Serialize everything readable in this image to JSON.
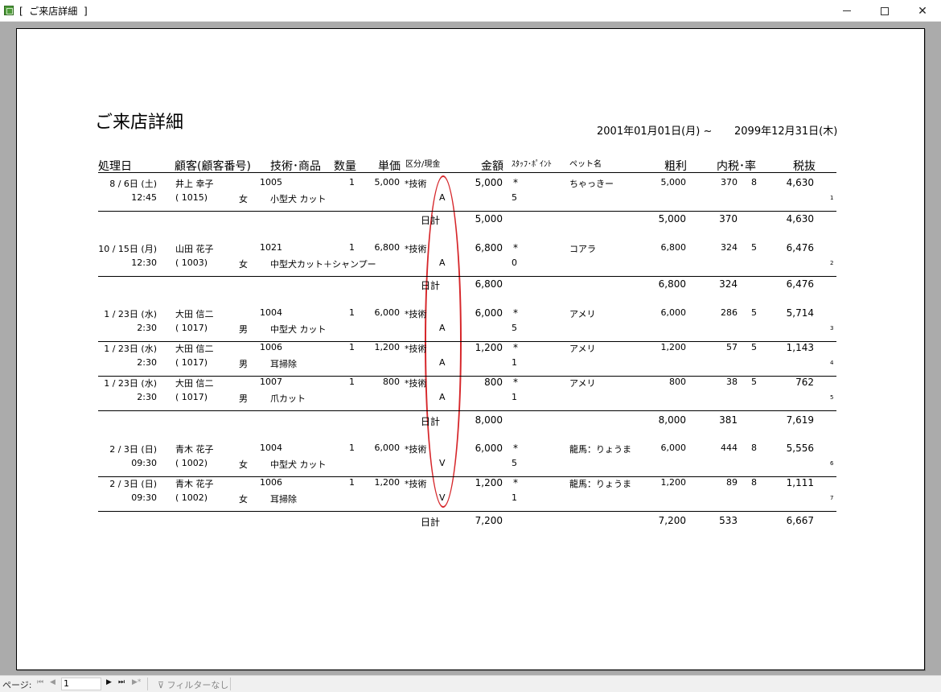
{
  "window": {
    "title": "[  ご来店詳細  ]",
    "minimize": "—",
    "maximize": "☐",
    "close": "✕"
  },
  "report": {
    "title": "ご来店詳細",
    "period_start": "2001年01月01日(月) ~",
    "period_end": "2099年12月31日(木)"
  },
  "headers": {
    "date": "処理日",
    "customer": "顧客(顧客番号)",
    "item": "技術･商品",
    "qty": "数量",
    "unit_price": "単価",
    "category": "区分/現金",
    "amount": "金額",
    "staff_point": "ｽﾀｯﾌ･ﾎﾟｲﾝﾄ",
    "pet_name": "ペット名",
    "gross": "粗利",
    "tax_rate": "内税･率",
    "net": "税抜"
  },
  "records": [
    {
      "date": "8 / 6日 (土)",
      "time": "12:45",
      "name": "井上  幸子",
      "cust_no": "(  1015)",
      "gender": "女",
      "code": "1005",
      "item": "小型犬 カット",
      "qty": "1",
      "unit": "5,000",
      "kind": "*技術",
      "cash": "A",
      "amount": "5,000",
      "staff": "*",
      "point": "5",
      "pet": "ちゃっきー",
      "gross": "5,000",
      "tax": "370",
      "rate": "8",
      "net": "4,630",
      "seq": "1"
    },
    {
      "date": "10 / 15日 (月)",
      "time": "12:30",
      "name": "山田  花子",
      "cust_no": "(  1003)",
      "gender": "女",
      "code": "1021",
      "item": "中型犬カット＋シャンプー",
      "qty": "1",
      "unit": "6,800",
      "kind": "*技術",
      "cash": "A",
      "amount": "6,800",
      "staff": "*",
      "point": "0",
      "pet": "コアラ",
      "gross": "6,800",
      "tax": "324",
      "rate": "5",
      "net": "6,476",
      "seq": "2"
    },
    {
      "date": "1 / 23日 (水)",
      "time": "2:30",
      "name": "大田  信二",
      "cust_no": "(  1017)",
      "gender": "男",
      "code": "1004",
      "item": "中型犬 カット",
      "qty": "1",
      "unit": "6,000",
      "kind": "*技術",
      "cash": "A",
      "amount": "6,000",
      "staff": "*",
      "point": "5",
      "pet": "アメリ",
      "gross": "6,000",
      "tax": "286",
      "rate": "5",
      "net": "5,714",
      "seq": "3"
    },
    {
      "date": "1 / 23日 (水)",
      "time": "2:30",
      "name": "大田  信二",
      "cust_no": "(  1017)",
      "gender": "男",
      "code": "1006",
      "item": "耳掃除",
      "qty": "1",
      "unit": "1,200",
      "kind": "*技術",
      "cash": "A",
      "amount": "1,200",
      "staff": "*",
      "point": "1",
      "pet": "アメリ",
      "gross": "1,200",
      "tax": "57",
      "rate": "5",
      "net": "1,143",
      "seq": "4"
    },
    {
      "date": "1 / 23日 (水)",
      "time": "2:30",
      "name": "大田  信二",
      "cust_no": "(  1017)",
      "gender": "男",
      "code": "1007",
      "item": "爪カット",
      "qty": "1",
      "unit": "800",
      "kind": "*技術",
      "cash": "A",
      "amount": "800",
      "staff": "*",
      "point": "1",
      "pet": "アメリ",
      "gross": "800",
      "tax": "38",
      "rate": "5",
      "net": "762",
      "seq": "5"
    },
    {
      "date": "2 / 3日 (日)",
      "time": "09:30",
      "name": "青木  花子",
      "cust_no": "(  1002)",
      "gender": "女",
      "code": "1004",
      "item": "中型犬 カット",
      "qty": "1",
      "unit": "6,000",
      "kind": "*技術",
      "cash": "V",
      "amount": "6,000",
      "staff": "*",
      "point": "5",
      "pet": "龍馬：りょうま",
      "gross": "6,000",
      "tax": "444",
      "rate": "8",
      "net": "5,556",
      "seq": "6"
    },
    {
      "date": "2 / 3日 (日)",
      "time": "09:30",
      "name": "青木  花子",
      "cust_no": "(  1002)",
      "gender": "女",
      "code": "1006",
      "item": "耳掃除",
      "qty": "1",
      "unit": "1,200",
      "kind": "*技術",
      "cash": "V",
      "amount": "1,200",
      "staff": "*",
      "point": "1",
      "pet": "龍馬：りょうま",
      "gross": "1,200",
      "tax": "89",
      "rate": "8",
      "net": "1,111",
      "seq": "7"
    }
  ],
  "subtotals": [
    {
      "label": "日計",
      "amount": "5,000",
      "gross": "5,000",
      "tax": "370",
      "net": "4,630"
    },
    {
      "label": "日計",
      "amount": "6,800",
      "gross": "6,800",
      "tax": "324",
      "net": "6,476"
    },
    {
      "label": "日計",
      "amount": "8,000",
      "gross": "8,000",
      "tax": "381",
      "net": "7,619"
    },
    {
      "label": "日計",
      "amount": "7,200",
      "gross": "7,200",
      "tax": "533",
      "net": "6,667"
    }
  ],
  "statusbar": {
    "page_label": "ページ:",
    "page_value": "1",
    "first": "⏮",
    "prev": "◀",
    "next": "▶",
    "last": "⏭",
    "new": "▶*",
    "filter": "フィルターなし"
  },
  "colors": {
    "annotation_oval": "#d6262a",
    "viewer_background": "#ababab"
  }
}
